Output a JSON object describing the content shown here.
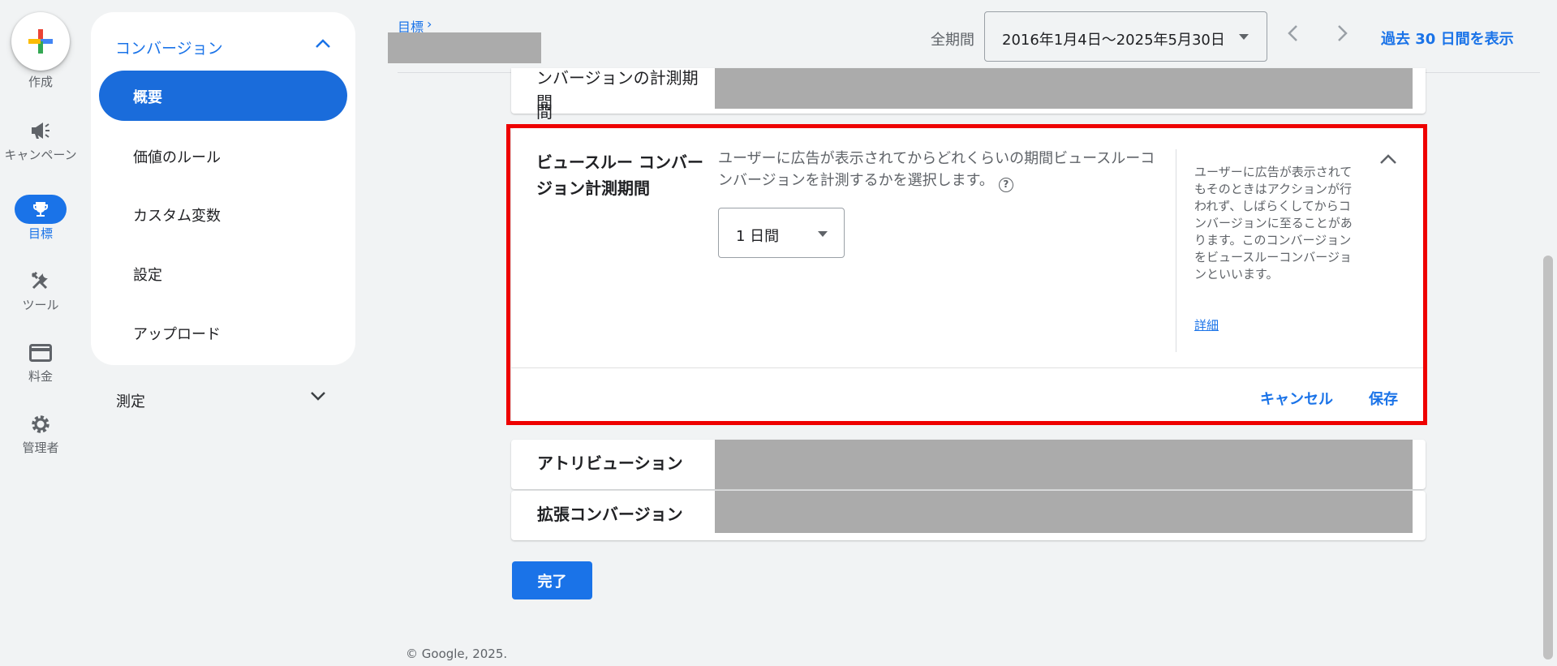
{
  "rail": {
    "create_label": "作成",
    "items": [
      {
        "label": "キャンペーン",
        "icon": "megaphone-icon"
      },
      {
        "label": "目標",
        "icon": "trophy-icon"
      },
      {
        "label": "ツール",
        "icon": "tools-icon"
      },
      {
        "label": "料金",
        "icon": "credit-card-icon"
      },
      {
        "label": "管理者",
        "icon": "gear-icon"
      }
    ]
  },
  "nav": {
    "section_title": "コンバージョン",
    "items": [
      "概要",
      "価値のルール",
      "カスタム変数",
      "設定",
      "アップロード"
    ],
    "active_index": 0,
    "measure_label": "測定"
  },
  "header": {
    "breadcrumb": "目標",
    "breadcrumb_sep": "›",
    "period_label": "全期間",
    "date_range": "2016年1月4日〜2025年5月30日",
    "show_last_30": "過去 30 日間を表示"
  },
  "cards": {
    "partial_title": "ンバージョンの計測期間",
    "view_through": {
      "title": "ビュースルー コンバージョン計測期間",
      "description": "ユーザーに広告が表示されてからどれくらいの期間ビュースルーコンバージョンを計測するかを選択します。",
      "help_symbol": "?",
      "selected_value": "1 日間",
      "side_help": "ユーザーに広告が表示されてもそのときはアクションが行われず、しばらくしてからコンバージョンに至ることがあります。このコンバージョンをビュースルーコンバージョンといいます。",
      "details_link": "詳細",
      "cancel_label": "キャンセル",
      "save_label": "保存"
    },
    "attribution_title": "アトリビューション",
    "enhanced_title": "拡張コンバージョン"
  },
  "done_label": "完了",
  "footer": "© Google, 2025.",
  "colors": {
    "accent": "#1a73e8",
    "highlight_frame": "#ee0000",
    "redacted": "#ababab"
  }
}
